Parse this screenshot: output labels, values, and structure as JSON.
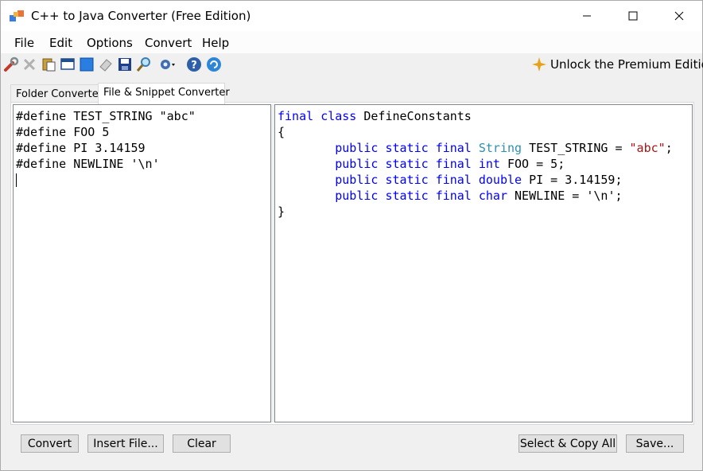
{
  "window": {
    "title": "C++ to Java Converter (Free Edition)"
  },
  "menu": {
    "items": [
      "File",
      "Edit",
      "Options",
      "Convert",
      "Help"
    ]
  },
  "toolbar": {
    "icons": [
      "wrench-icon",
      "delete-icon",
      "paste-icon",
      "window-icon",
      "select-icon",
      "eraser-icon",
      "save-icon",
      "find-icon",
      "settings-icon",
      "help-icon",
      "refresh-icon"
    ],
    "unlock_label": "Unlock the Premium Edition"
  },
  "tabs": [
    {
      "label": "Folder Converter",
      "active": false
    },
    {
      "label": "File & Snippet Converter",
      "active": true
    }
  ],
  "editor": {
    "input_lines": [
      "#define TEST_STRING \"abc\"",
      "#define FOO 5",
      "#define PI 3.14159",
      "#define NEWLINE '\\n'"
    ],
    "output_lines": [
      "final class DefineConstants",
      "{",
      "\tpublic static final String TEST_STRING = \"abc\";",
      "\tpublic static final int FOO = 5;",
      "\tpublic static final double PI = 3.14159;",
      "\tpublic static final char NEWLINE = '\\n';",
      "}"
    ]
  },
  "buttons": {
    "convert": "Convert",
    "insert_file": "Insert File...",
    "clear": "Clear",
    "select_copy_all": "Select & Copy All",
    "save": "Save..."
  },
  "colors": {
    "keyword": "#0000ff",
    "type": "#2b91af",
    "string": "#a31515"
  }
}
